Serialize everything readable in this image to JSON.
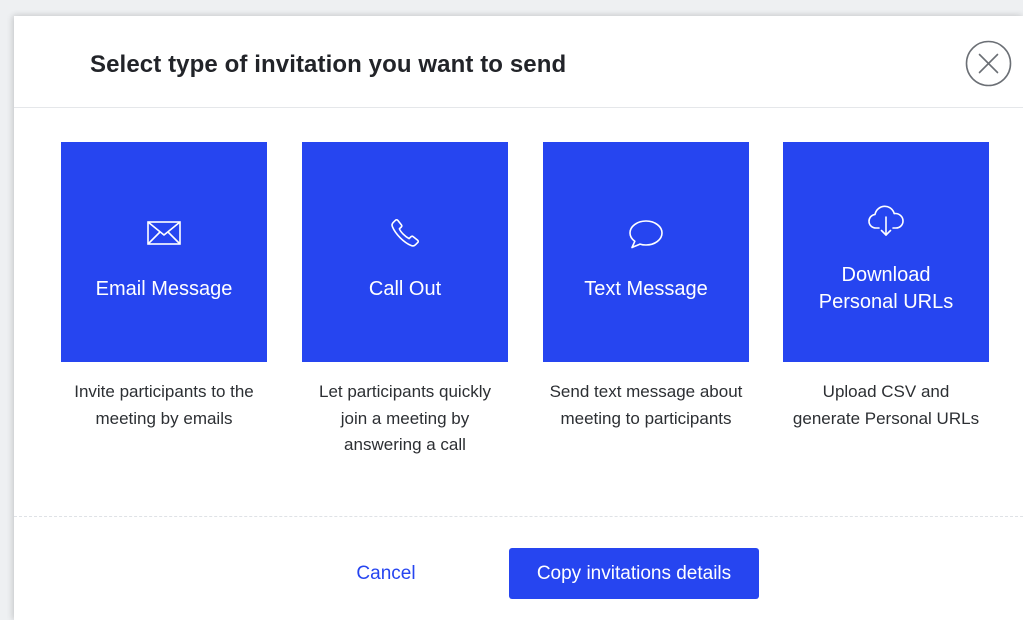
{
  "dialog": {
    "title": "Select type of invitation you want to send",
    "close_icon": "close-circle-icon"
  },
  "options": [
    {
      "id": "email",
      "icon": "envelope-icon",
      "label": "Email Message",
      "description": "Invite participants to the meeting by emails"
    },
    {
      "id": "call",
      "icon": "phone-icon",
      "label": "Call Out",
      "description": "Let participants quickly join a meeting by answering a call"
    },
    {
      "id": "text",
      "icon": "chat-bubble-icon",
      "label": "Text Message",
      "description": "Send text message about meeting to participants"
    },
    {
      "id": "download",
      "icon": "cloud-download-icon",
      "label": "Download Personal URLs",
      "description": "Upload CSV and generate Personal URLs"
    }
  ],
  "footer": {
    "cancel_label": "Cancel",
    "copy_label": "Copy invitations details"
  },
  "colors": {
    "accent": "#2645f0",
    "tile_text": "#ffffff",
    "title_text": "#222429",
    "body_text": "#2c2f33",
    "close_icon": "#6b6f75"
  }
}
